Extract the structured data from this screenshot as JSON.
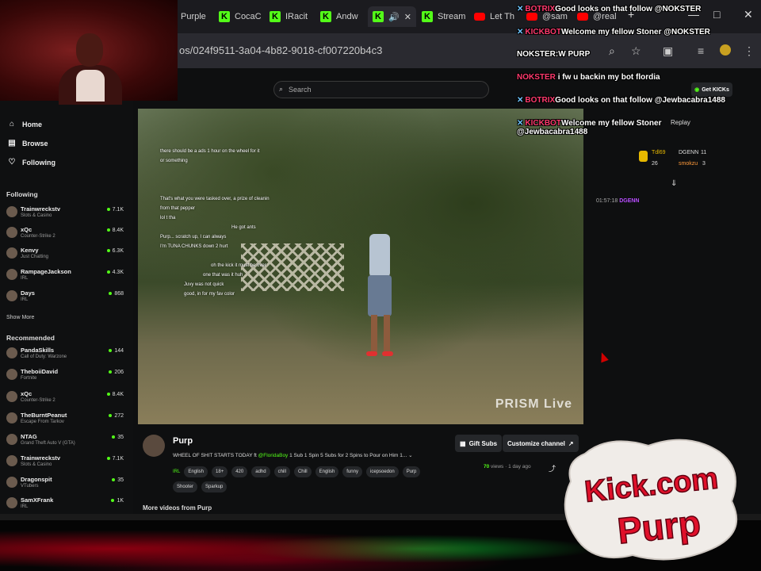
{
  "browser": {
    "tabs": [
      {
        "label": "Purple",
        "icon": "kick"
      },
      {
        "label": "CocaC",
        "icon": "kick"
      },
      {
        "label": "IRacit",
        "icon": "kick"
      },
      {
        "label": "Andw",
        "icon": "kick"
      },
      {
        "label": "",
        "icon": "kick",
        "active": true,
        "close": "✕"
      },
      {
        "label": "Stream",
        "icon": "kick"
      },
      {
        "label": "Let Th",
        "icon": "youtube"
      },
      {
        "label": "@sam",
        "icon": "youtube"
      },
      {
        "label": "@real",
        "icon": "youtube"
      }
    ],
    "url": "os/024f9511-3a04-4b82-9018-cf007220b4c3",
    "window_controls": {
      "minimize": "—",
      "maximize": "□",
      "close": "✕"
    }
  },
  "page": {
    "search_placeholder": "Search",
    "sidebar": {
      "nav": [
        {
          "label": "Home",
          "icon": "home-icon"
        },
        {
          "label": "Browse",
          "icon": "browse-icon"
        },
        {
          "label": "Following",
          "icon": "heart-icon"
        }
      ],
      "following_heading": "Following",
      "following": [
        {
          "name": "Trainwreckstv",
          "game": "Slots & Casino",
          "viewers": "7.1K"
        },
        {
          "name": "xQc",
          "game": "Counter-Strike 2",
          "viewers": "8.4K"
        },
        {
          "name": "Kenvy",
          "game": "Just Chatting",
          "viewers": "6.3K"
        },
        {
          "name": "RampageJackson",
          "game": "IRL",
          "viewers": "4.3K"
        },
        {
          "name": "Days",
          "game": "IRL",
          "viewers": "868"
        }
      ],
      "show_more": "Show More",
      "recommended_heading": "Recommended",
      "recommended": [
        {
          "name": "PandaSkills",
          "game": "Call of Duty: Warzone",
          "viewers": "144"
        },
        {
          "name": "TheboiiDavid",
          "game": "Fortnite",
          "viewers": "206"
        },
        {
          "name": "xQc",
          "game": "Counter-Strike 2",
          "viewers": "8.4K"
        },
        {
          "name": "TheBurntPeanut",
          "game": "Escape From Tarkov",
          "viewers": "272"
        },
        {
          "name": "NTAG",
          "game": "Grand Theft Auto V (GTA)",
          "viewers": "35"
        },
        {
          "name": "Trainwreckstv",
          "game": "Slots & Casino",
          "viewers": "7.1K"
        },
        {
          "name": "Dragonspit",
          "game": "VTubers",
          "viewers": "35"
        },
        {
          "name": "SamXFrank",
          "game": "IRL",
          "viewers": "1K"
        }
      ]
    },
    "video": {
      "watermark": "PRISM Live",
      "overlay_chat": [
        {
          "user": "",
          "text": "there should be a ads 1 hour on the wheel for it"
        },
        {
          "user": "",
          "text": "or something"
        },
        {
          "user": "",
          "text": ""
        },
        {
          "user": "",
          "text": ""
        },
        {
          "user": "",
          "text": ""
        },
        {
          "user": "",
          "text": "That's what you were tasked over, a prize of cleanin"
        },
        {
          "user": "",
          "text": "from that pepper"
        },
        {
          "user": "",
          "text": "lol t tha"
        },
        {
          "user": "",
          "text": "He got ants"
        },
        {
          "user": "",
          "text": "Purp... scratch up, I can always"
        },
        {
          "user": "",
          "text": "I'm TUNA CHUNKS down 2 hurt"
        },
        {
          "user": "",
          "text": ""
        },
        {
          "user": "",
          "text": "oh the kick it must be over"
        },
        {
          "user": "",
          "text": "one that was it huh"
        },
        {
          "user": "",
          "text": "Juvy was not quick"
        },
        {
          "user": "",
          "text": "good, in for my fav color"
        }
      ]
    },
    "channel": {
      "name": "Purp",
      "title_prefix": "WHEEL OF SHIT STARTS TODAY ft ",
      "title_mention": "@FloridaBoy",
      "title_suffix": " 1 Sub 1 Spin 5 Subs for 2 Spins to Pour on Him 1...",
      "category": "IRL",
      "tags": [
        "English",
        "18+",
        "420",
        "adhd",
        "chill",
        "Chill",
        "English",
        "funny",
        "icepsoedon",
        "Purp",
        "Shooter",
        "Sparkup"
      ],
      "gift_subs": "Gift Subs",
      "customize": "Customize channel",
      "views": "70",
      "views_label": "views",
      "age": "1 day ago",
      "more_videos": "More videos from Purp"
    },
    "chat": {
      "get_kicks": "Get KICKs",
      "replay": "Replay",
      "leaderboard": [
        {
          "name": "Tdl69",
          "value": "26"
        },
        {
          "name": "DGENN",
          "value": "11"
        },
        {
          "name": "smokzu",
          "value": "3"
        }
      ],
      "line": {
        "time": "01:57:18",
        "user": "DGENN"
      }
    }
  },
  "stream_overlay": {
    "lines": [
      {
        "user": "BOTRIX",
        "text": "Good looks on that follow @NOKSTER",
        "badge": "✕",
        "user_color": "#ff3a6e"
      },
      {
        "user": "KICKBOT",
        "text": "Welcome my fellow Stoner @NOKSTER",
        "badge": "✕",
        "user_color": "#ff3a6e"
      },
      {
        "user": "NOKSTER:",
        "text": "W PURP",
        "badge": "",
        "user_color": "#ffffff"
      },
      {
        "user": "NOKSTER",
        "text": "i fw u backin my bot flordia",
        "badge": "",
        "user_color": "#ff3a6e"
      },
      {
        "user": "BOTRIX",
        "text": "Good looks on that follow @Jewbacabra1488",
        "badge": "✕",
        "user_color": "#ff3a6e"
      },
      {
        "user": "KICKBOT",
        "text": "Welcome my fellow Stoner @Jewbacabra1488",
        "badge": "✕",
        "user_color": "#ff3a6e"
      }
    ]
  },
  "logo": {
    "line1": "Kick.com",
    "line2": "Purp"
  },
  "colors": {
    "kick_green": "#53fc18",
    "overlay_user": "#ff3a6e",
    "logo_red": "#e0102a"
  }
}
